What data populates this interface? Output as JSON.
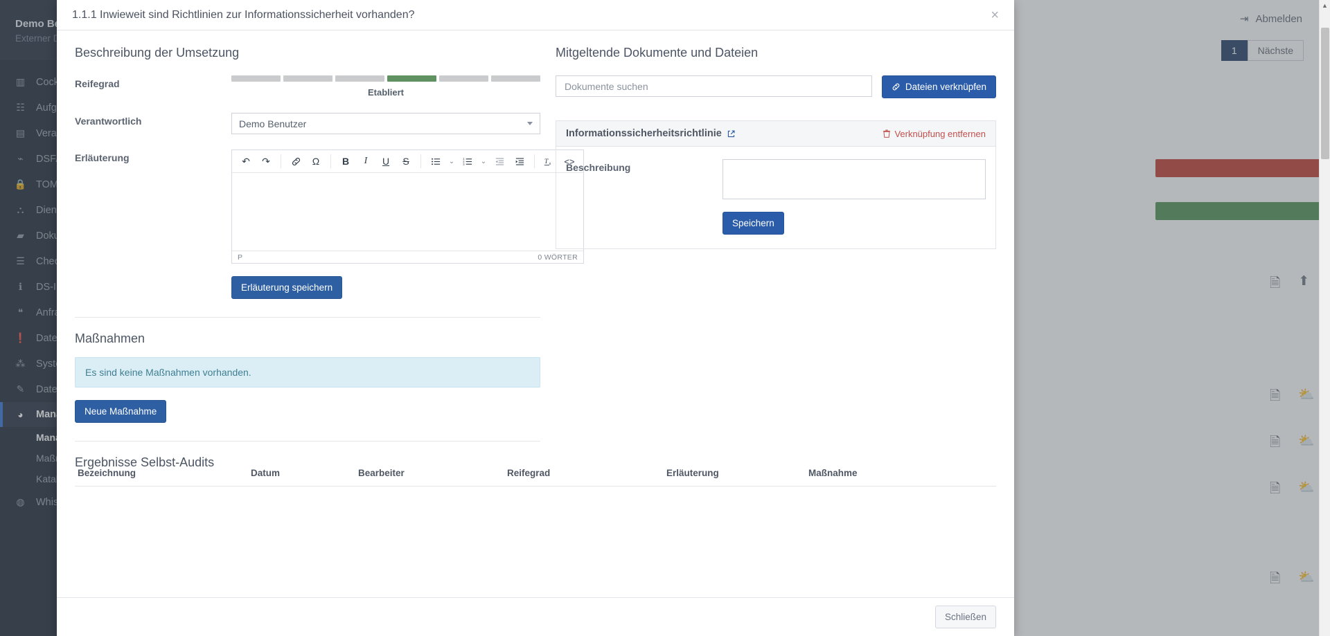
{
  "sidebar": {
    "user": {
      "name": "Demo Benutzer",
      "role": "Externer DSB"
    },
    "items": [
      {
        "label": "Cockpit",
        "icon": "chart-bar-icon"
      },
      {
        "label": "Aufgaben",
        "icon": "task-list-icon"
      },
      {
        "label": "Verarbeitungen",
        "icon": "table-icon"
      },
      {
        "label": "DSFA",
        "icon": "line-chart-icon"
      },
      {
        "label": "TOM",
        "icon": "lock-icon"
      },
      {
        "label": "Dienstleister",
        "icon": "handshake-icon"
      },
      {
        "label": "Dokumente",
        "icon": "folder-icon"
      },
      {
        "label": "Checklisten",
        "icon": "list-icon"
      },
      {
        "label": "DS-Informationen",
        "icon": "info-icon"
      },
      {
        "label": "Anfragen",
        "icon": "comments-icon"
      },
      {
        "label": "Datenschutzvorfälle",
        "icon": "exclamation-icon"
      },
      {
        "label": "Systemlandschaft",
        "icon": "network-icon"
      },
      {
        "label": "Datenschutzaudits",
        "icon": "audit-icon"
      },
      {
        "label": "Management",
        "icon": "dashboard-icon",
        "active": true
      },
      {
        "label": "Whistleblowing",
        "icon": "megaphone-icon"
      }
    ],
    "subitems": [
      {
        "label": "Managementsystem",
        "active": true
      },
      {
        "label": "Maßnahmen",
        "active": false
      },
      {
        "label": "Kataloge",
        "active": false
      }
    ]
  },
  "topbar": {
    "logout_label": "Abmelden",
    "logout_icon": "sign-out-icon"
  },
  "pager": {
    "current": "1",
    "next_label": "Nächste"
  },
  "modal": {
    "title": "1.1.1 Inwieweit sind Richtlinien zur Informationssicherheit vorhanden?",
    "close_icon": "close-icon",
    "left": {
      "section_title": "Beschreibung der Umsetzung",
      "maturity": {
        "label": "Reifegrad",
        "segments": 6,
        "active_index": 4,
        "value_label": "Etabliert"
      },
      "responsible": {
        "label": "Verantwortlich",
        "value": "Demo Benutzer",
        "caret_icon": "chevron-down-icon"
      },
      "explanation": {
        "label": "Erläuterung",
        "content": "",
        "path_label": "P",
        "word_count": "0 WÖRTER",
        "toolbar": [
          {
            "name": "undo-icon",
            "glyph": "↶"
          },
          {
            "name": "redo-icon",
            "glyph": "↷"
          },
          {
            "sep": true
          },
          {
            "name": "link-icon",
            "glyph": "🔗"
          },
          {
            "name": "special-character-icon",
            "glyph": "Ω"
          },
          {
            "sep": true
          },
          {
            "name": "bold-icon",
            "glyph": "B"
          },
          {
            "name": "italic-icon",
            "glyph": "I"
          },
          {
            "name": "underline-icon",
            "glyph": "U"
          },
          {
            "name": "strikethrough-icon",
            "glyph": "S"
          },
          {
            "sep": true
          },
          {
            "name": "bulleted-list-icon",
            "glyph": "☰"
          },
          {
            "name": "bulleted-list-dropdown-icon",
            "glyph": "⌄"
          },
          {
            "name": "numbered-list-icon",
            "glyph": "☰"
          },
          {
            "name": "numbered-list-dropdown-icon",
            "glyph": "⌄"
          },
          {
            "name": "decrease-indent-icon",
            "glyph": "⇤"
          },
          {
            "name": "increase-indent-icon",
            "glyph": "⇥"
          },
          {
            "sep": true
          },
          {
            "name": "remove-format-icon",
            "glyph": "Tx"
          },
          {
            "name": "source-code-icon",
            "glyph": "<>"
          }
        ],
        "save_button": "Erläuterung speichern"
      },
      "measures": {
        "title": "Maßnahmen",
        "empty_text": "Es sind keine Maßnahmen vorhanden.",
        "new_button": "Neue Maßnahme"
      },
      "audit_results": {
        "title": "Ergebnisse Selbst-Audits",
        "columns": [
          "Bezeichnung",
          "Datum",
          "Bearbeiter",
          "Reifegrad",
          "Erläuterung",
          "Maßnahme"
        ],
        "rows": []
      }
    },
    "right": {
      "section_title": "Mitgeltende Dokumente und Dateien",
      "search_placeholder": "Dokumente suchen",
      "link_button": {
        "label": "Dateien verknüpfen",
        "icon": "link-icon"
      },
      "linked_doc": {
        "title": "Informationssicherheitsrichtlinie",
        "external_icon": "external-link-icon",
        "unlink_label": "Verknüpfung entfernen",
        "unlink_icon": "trash-icon",
        "description_label": "Beschreibung",
        "description_value": "",
        "save_button": "Speichern"
      }
    },
    "footer": {
      "close_button": "Schließen"
    }
  },
  "colors": {
    "primary": "#2e5fa3",
    "maturity_active": "#5f9161",
    "maturity_inactive": "#c9cbcd",
    "danger": "#c0504d",
    "info_bg": "#dbeef6",
    "sidebar_bg": "#1b2433"
  }
}
